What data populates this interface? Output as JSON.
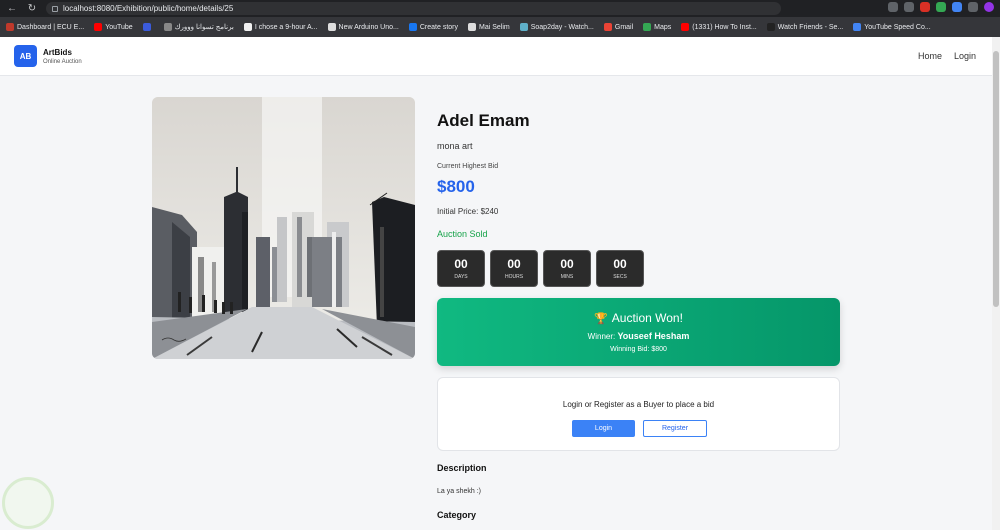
{
  "browser": {
    "url": "localhost:8080/Exhibition/public/home/details/25",
    "bookmarks": [
      {
        "label": "Dashboard | ECU E...",
        "color": "#c0392b"
      },
      {
        "label": "YouTube",
        "color": "#ff0000"
      },
      {
        "label": "",
        "color": "#3b5bdb"
      },
      {
        "label": "برنامج تسوانا ووورك",
        "color": "#888888"
      },
      {
        "label": "I chose a 9-hour A...",
        "color": "#f0f0f0"
      },
      {
        "label": "New Arduino Uno...",
        "color": "#dddddd"
      },
      {
        "label": "Create story",
        "color": "#1877f2"
      },
      {
        "label": "Mai Selim",
        "color": "#dddddd"
      },
      {
        "label": "Soap2day - Watch...",
        "color": "#5fb0c9"
      },
      {
        "label": "Gmail",
        "color": "#ea4335"
      },
      {
        "label": "Maps",
        "color": "#34a853"
      },
      {
        "label": "(1331) How To Inst...",
        "color": "#ff0000"
      },
      {
        "label": "Watch Friends - Se...",
        "color": "#222222"
      },
      {
        "label": "YouTube Speed Co...",
        "color": "#4285f4"
      }
    ]
  },
  "header": {
    "logo_text": "AB",
    "brand_name": "ArtBids",
    "brand_tagline": "Online Auction",
    "nav": [
      "Home",
      "Login"
    ]
  },
  "artwork": {
    "artist": "Adel Emam",
    "title": "mona art",
    "highest_bid_label": "Current Highest Bid",
    "highest_bid": "$800",
    "initial_price": "Initial Price: $240",
    "status": "Auction Sold"
  },
  "countdown": [
    {
      "value": "00",
      "label": "DAYS"
    },
    {
      "value": "00",
      "label": "HOURS"
    },
    {
      "value": "00",
      "label": "MINS"
    },
    {
      "value": "00",
      "label": "SECS"
    }
  ],
  "result": {
    "title": "Auction Won!",
    "winner_label": "Winner:",
    "winner_name": "Youseef Hesham",
    "winning_bid": "Winning Bid: $800"
  },
  "auth": {
    "message": "Login or Register as a Buyer to place a bid",
    "login_label": "Login",
    "register_label": "Register"
  },
  "details": {
    "description_heading": "Description",
    "description_text": "La ya shekh :)",
    "category_heading": "Category"
  },
  "colors": {
    "accent": "#2563eb",
    "success": "#16a34a",
    "won_banner": "#10b981"
  }
}
